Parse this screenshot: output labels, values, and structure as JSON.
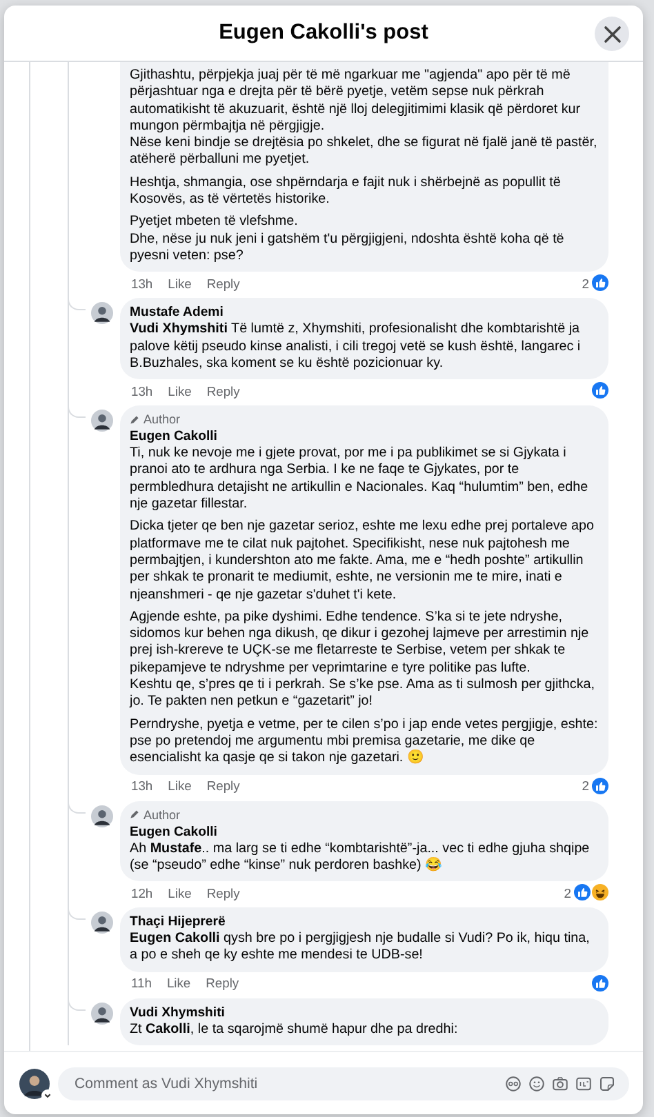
{
  "dialog": {
    "title": "Eugen Cakolli's post"
  },
  "comments": [
    {
      "paragraphs": [
        "Gjithashtu, përpjekja juaj për të më ngarkuar me \"agjenda\" apo për të më përjashtuar nga e drejta për të bërë pyetje, vetëm sepse nuk përkrah automatikisht të akuzuarit, është një lloj delegjitimimi klasik që përdoret kur mungon përmbajtja në përgjigje.\nNëse keni bindje se drejtësia po shkelet, dhe se figurat në fjalë janë të pastër, atëherë përballuni me pyetjet.",
        "Heshtja, shmangia, ose shpërndarja e fajit nuk i shërbejnë as popullit të Kosovës, as të vërtetës historike.",
        "Pyetjet mbeten të vlefshme.\nDhe, nëse ju nuk jeni i gatshëm t'u përgjigjeni, ndoshta është koha që të pyesni veten: pse?"
      ],
      "time": "13h",
      "actions": [
        "Like",
        "Reply"
      ],
      "reaction_count": "2",
      "reactions": [
        {
          "kind": "like"
        }
      ]
    },
    {
      "author": "Mustafe Ademi",
      "paragraphs": [
        "**Vudi Xhymshiti** Të lumtë z, Xhymshiti, profesionalisht dhe kombtarishtë ja palove këtij pseudo kinse analisti, i cili tregoj vetë se kush është, langarec i B.Buzhales, ska koment se ku është pozicionuar ky."
      ],
      "time": "13h",
      "actions": [
        "Like",
        "Reply"
      ],
      "reactions": [
        {
          "kind": "like"
        }
      ]
    },
    {
      "badge": "Author",
      "author": "Eugen Cakolli",
      "paragraphs": [
        "Ti, nuk ke nevoje me i gjete provat, por me i pa publikimet se si Gjykata i pranoi ato te ardhura nga Serbia. I ke ne faqe te Gjykates, por te permbledhura detajisht ne artikullin e Nacionales. Kaq “hulumtim” ben, edhe nje gazetar fillestar.",
        "Dicka tjeter qe ben nje gazetar serioz, eshte me lexu edhe prej portaleve apo platformave me te cilat nuk pajtohet. Specifikisht, nese nuk pajtohesh me permbajtjen, i kundershton ato me fakte. Ama, me e “hedh poshte” artikullin per shkak te pronarit te mediumit, eshte, ne versionin me te mire, inati e njeanshmeri - qe nje gazetar s'duhet t'i kete.",
        "Agjende eshte, pa pike dyshimi. Edhe tendence. S’ka si te jete ndryshe, sidomos kur behen nga dikush, qe dikur i gezohej lajmeve per arrestimin nje prej ish-krereve te UÇK-se me fletarreste te Serbise, vetem per shkak te pikepamjeve te ndryshme per veprimtarine e tyre politike pas lufte.\nKeshtu qe, s’pres qe ti i perkrah. Se s’ke pse. Ama as ti sulmosh per gjithcka, jo. Te pakten nen petkun e “gazetarit” jo!",
        "Perndryshe, pyetja e vetme, per te cilen s’po i jap ende vetes pergjigje, eshte: pse po pretendoj me argumentu mbi premisa gazetarie, me dike qe esencialisht ka qasje qe si takon nje gazetari. 🙂"
      ],
      "time": "13h",
      "actions": [
        "Like",
        "Reply"
      ],
      "reaction_count": "2",
      "reactions": [
        {
          "kind": "like"
        }
      ]
    },
    {
      "badge": "Author",
      "author": "Eugen Cakolli",
      "paragraphs": [
        "Ah **Mustafe**.. ma larg se ti edhe “kombtarishtë”-ja... vec ti edhe gjuha shqipe (se “pseudo” edhe “kinse” nuk perdoren bashke) 😂"
      ],
      "time": "12h",
      "actions": [
        "Like",
        "Reply"
      ],
      "reaction_count": "2",
      "reactions": [
        {
          "kind": "like"
        },
        {
          "kind": "haha"
        }
      ]
    },
    {
      "author": "Thaçi Hijeprerë",
      "paragraphs": [
        "**Eugen Cakolli** qysh bre po i pergjigjesh nje budalle si Vudi? Po ik, hiqu tina, a po e sheh qe ky eshte me mendesi te UDB-se!"
      ],
      "time": "11h",
      "actions": [
        "Like",
        "Reply"
      ],
      "reactions": [
        {
          "kind": "like"
        }
      ]
    },
    {
      "author": "Vudi Xhymshiti",
      "paragraphs": [
        "Zt **Cakolli**, le ta sqarojmë shumë hapur dhe pa dredhi:"
      ]
    }
  ],
  "composer": {
    "placeholder": "Comment as Vudi Xhymshiti"
  }
}
